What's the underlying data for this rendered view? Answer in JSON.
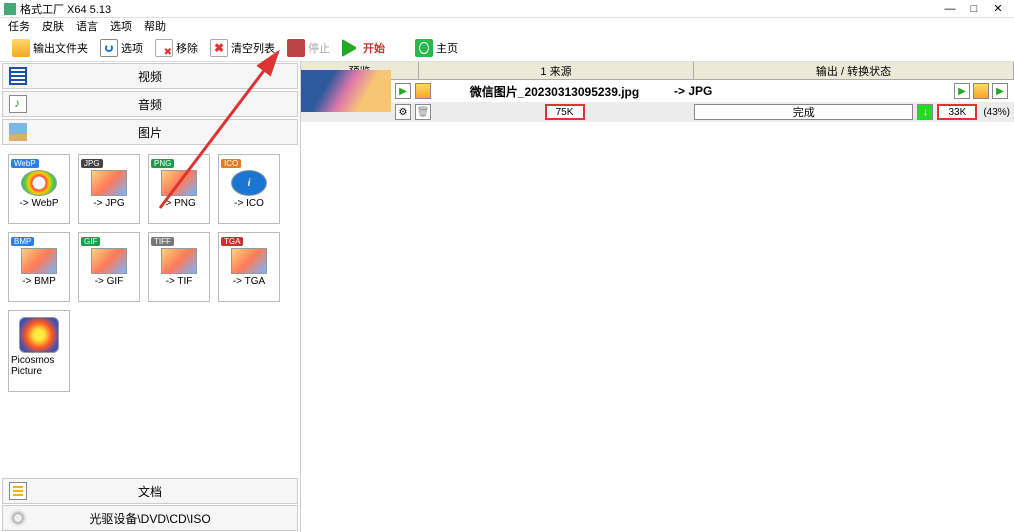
{
  "window": {
    "title": "格式工厂 X64 5.13",
    "controls": {
      "min": "—",
      "max": "□",
      "close": "✕"
    }
  },
  "menu": [
    "任务",
    "皮肤",
    "语言",
    "选项",
    "帮助"
  ],
  "toolbar": {
    "output_folder": "输出文件夹",
    "options": "选项",
    "remove": "移除",
    "clear_list": "清空列表",
    "stop": "停止",
    "start": "开始",
    "homepage": "主页"
  },
  "categories": {
    "video": "视频",
    "audio": "音频",
    "image": "图片",
    "document": "文档",
    "optical": "光驱设备\\DVD\\CD\\ISO"
  },
  "format_tiles": [
    {
      "badge": "WebP",
      "badge_color": "#2b7de9",
      "label": "-> WebP",
      "cls": "webp"
    },
    {
      "badge": "JPG",
      "badge_color": "#444",
      "label": "-> JPG",
      "cls": "jpg"
    },
    {
      "badge": "PNG",
      "badge_color": "#1a9e4b",
      "label": "-> PNG",
      "cls": "png"
    },
    {
      "badge": "ICO",
      "badge_color": "#e27b19",
      "label": "-> ICO",
      "cls": "ico"
    },
    {
      "badge": "BMP",
      "badge_color": "#2b7de9",
      "label": "-> BMP",
      "cls": "bmp"
    },
    {
      "badge": "GIF",
      "badge_color": "#1a9e4b",
      "label": "-> GIF",
      "cls": "gif"
    },
    {
      "badge": "TIFF",
      "badge_color": "#777",
      "label": "-> TIF",
      "cls": "tif"
    },
    {
      "badge": "TGA",
      "badge_color": "#c7332e",
      "label": "-> TGA",
      "cls": "tga"
    },
    {
      "badge": "",
      "badge_color": "transparent",
      "label": "Picosmos Picture",
      "cls": "picosmos"
    }
  ],
  "list": {
    "columns": {
      "preview": "预览",
      "source": "1 来源",
      "output": "输出 / 转换状态"
    },
    "item": {
      "filename": "微信图片_20230313095239.jpg",
      "src_size": "75K",
      "out_format": "-> JPG",
      "status": "完成",
      "out_size": "33K",
      "pct": "(43%)"
    }
  }
}
